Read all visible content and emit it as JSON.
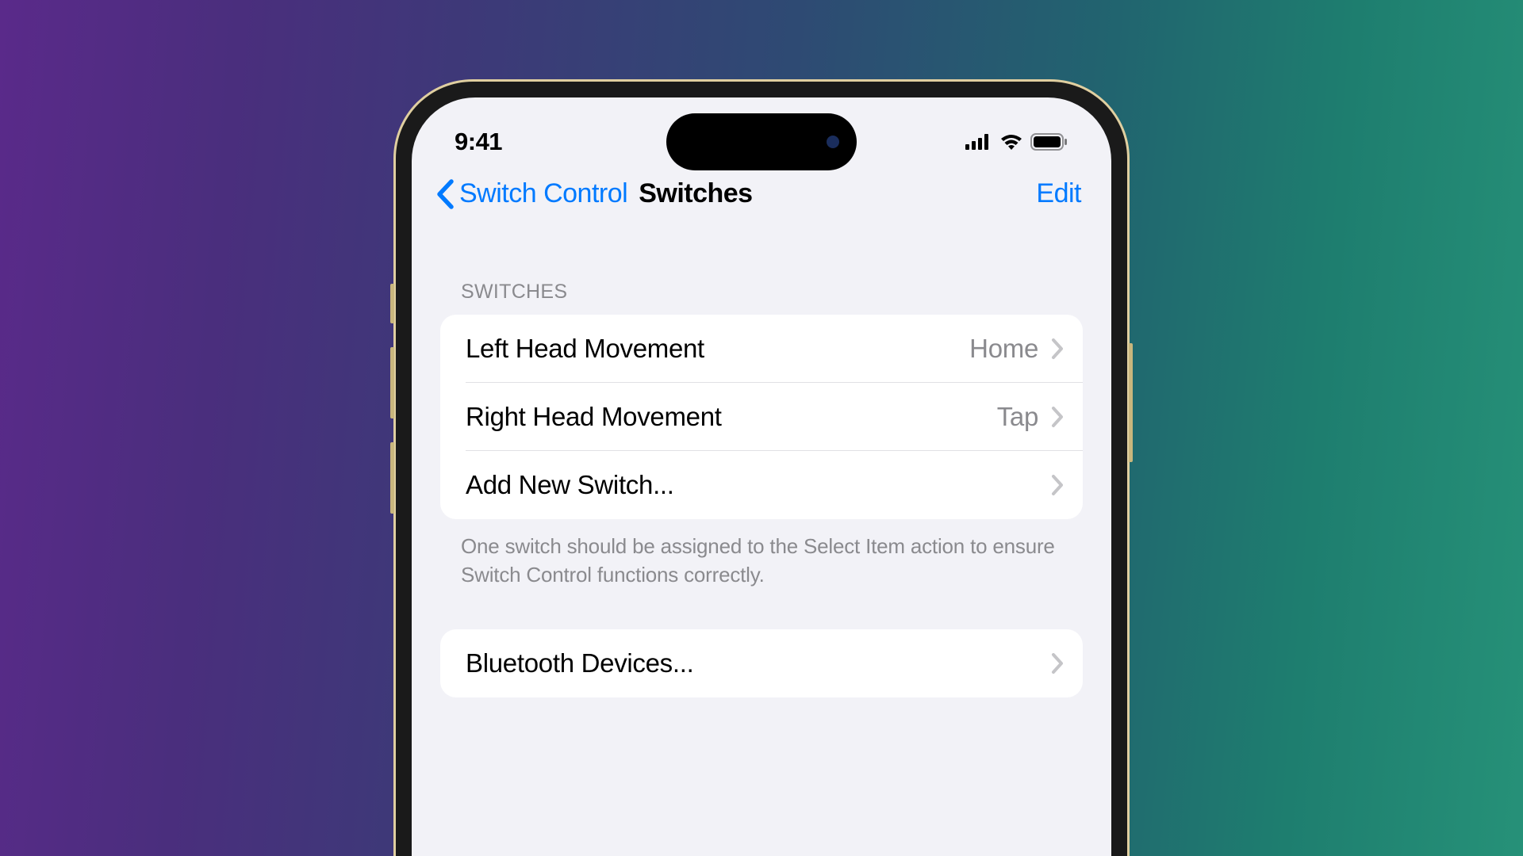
{
  "statusBar": {
    "time": "9:41"
  },
  "nav": {
    "backLabel": "Switch Control",
    "title": "Switches",
    "editLabel": "Edit"
  },
  "section1": {
    "header": "SWITCHES",
    "items": [
      {
        "label": "Left Head Movement",
        "value": "Home"
      },
      {
        "label": "Right Head Movement",
        "value": "Tap"
      },
      {
        "label": "Add New Switch...",
        "value": ""
      }
    ],
    "footer": "One switch should be assigned to the Select Item action to ensure Switch Control functions correctly."
  },
  "section2": {
    "items": [
      {
        "label": "Bluetooth Devices...",
        "value": ""
      }
    ]
  }
}
